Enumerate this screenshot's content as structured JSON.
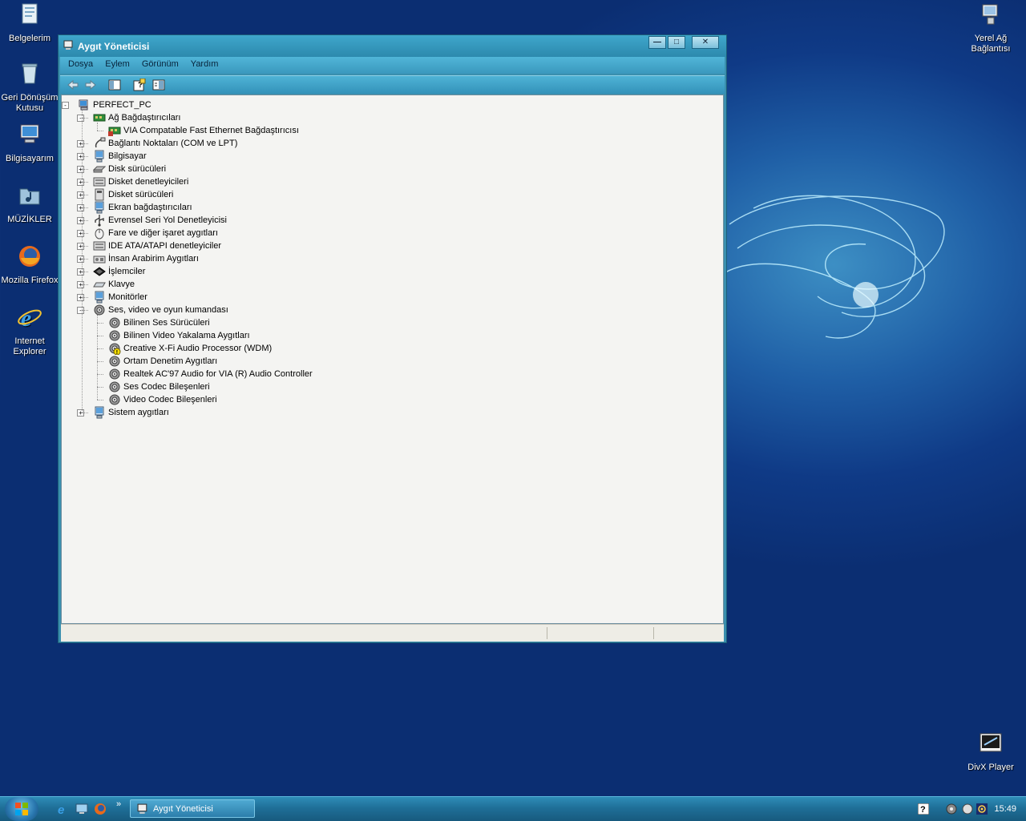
{
  "desktop": {
    "icons_left": [
      {
        "label": "Belgelerim",
        "icon": "documents-icon"
      },
      {
        "label": "Geri Dönüşüm Kutusu",
        "icon": "recycle-bin-icon"
      },
      {
        "label": "Bilgisayarım",
        "icon": "my-computer-icon"
      },
      {
        "label": "MÜZİKLER",
        "icon": "music-folder-icon"
      },
      {
        "label": "Mozilla Firefox",
        "icon": "firefox-icon"
      },
      {
        "label": "Internet Explorer",
        "icon": "internet-explorer-icon"
      }
    ],
    "network_icon": {
      "label": "Yerel Ağ Bağlantısı",
      "icon": "network-connection-icon"
    },
    "divx_icon": {
      "label": "DivX Player",
      "icon": "divx-player-icon"
    }
  },
  "window": {
    "title": "Aygıt Yöneticisi",
    "menu": [
      "Dosya",
      "Eylem",
      "Görünüm",
      "Yardım"
    ],
    "toolbar": [
      "back-arrow-icon",
      "forward-arrow-icon",
      "show-hide-tree-icon",
      "help-properties-icon",
      "properties-icon"
    ],
    "tree": {
      "root": "PERFECT_PC",
      "categories": [
        {
          "label": "Ağ Bağdaştırıcıları",
          "icon": "network-adapter-icon",
          "expanded": true,
          "children": [
            {
              "label": "VIA Compatable Fast Ethernet Bağdaştırıcısı",
              "icon": "network-card-icon"
            }
          ]
        },
        {
          "label": "Bağlantı Noktaları (COM ve LPT)",
          "icon": "port-icon"
        },
        {
          "label": "Bilgisayar",
          "icon": "computer-icon"
        },
        {
          "label": "Disk sürücüleri",
          "icon": "disk-drive-icon"
        },
        {
          "label": "Disket denetleyicileri",
          "icon": "floppy-controller-icon"
        },
        {
          "label": "Disket sürücüleri",
          "icon": "floppy-drive-icon"
        },
        {
          "label": "Ekran bağdaştırıcıları",
          "icon": "display-adapter-icon"
        },
        {
          "label": "Evrensel Seri Yol Denetleyicisi",
          "icon": "usb-icon"
        },
        {
          "label": "Fare ve diğer işaret aygıtları",
          "icon": "mouse-icon"
        },
        {
          "label": "IDE ATA/ATAPI denetleyiciler",
          "icon": "ide-controller-icon"
        },
        {
          "label": "İnsan Arabirim Aygıtları",
          "icon": "hid-icon"
        },
        {
          "label": "İşlemciler",
          "icon": "processor-icon"
        },
        {
          "label": "Klavye",
          "icon": "keyboard-icon"
        },
        {
          "label": "Monitörler",
          "icon": "monitor-icon"
        },
        {
          "label": "Ses, video ve oyun kumandası",
          "icon": "sound-icon",
          "expanded": true,
          "children": [
            {
              "label": "Bilinen Ses Sürücüleri",
              "icon": "sound-device-icon"
            },
            {
              "label": "Bilinen Video Yakalama Aygıtları",
              "icon": "sound-device-icon"
            },
            {
              "label": "Creative X-Fi Audio Processor (WDM)",
              "icon": "sound-device-warning-icon"
            },
            {
              "label": "Ortam Denetim Aygıtları",
              "icon": "sound-device-icon"
            },
            {
              "label": "Realtek AC'97 Audio for VIA (R) Audio Controller",
              "icon": "sound-device-icon"
            },
            {
              "label": "Ses Codec Bileşenleri",
              "icon": "sound-device-icon"
            },
            {
              "label": "Video Codec Bileşenleri",
              "icon": "sound-device-icon"
            }
          ]
        },
        {
          "label": "Sistem aygıtları",
          "icon": "system-device-icon"
        }
      ]
    }
  },
  "taskbar": {
    "task_label": "Aygıt Yöneticisi",
    "clock": "15:49"
  }
}
